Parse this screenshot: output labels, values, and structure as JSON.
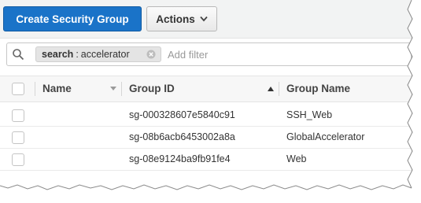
{
  "toolbar": {
    "create_label": "Create Security Group",
    "actions_label": "Actions",
    "primary_color": "#1a73c8"
  },
  "filter": {
    "token_key": "search",
    "token_separator": ":",
    "token_value": "accelerator",
    "placeholder": "Add filter"
  },
  "table": {
    "columns": [
      "Name",
      "Group ID",
      "Group Name"
    ],
    "rows": [
      {
        "name": "",
        "group_id": "sg-000328607e5840c91",
        "group_name": "SSH_Web"
      },
      {
        "name": "",
        "group_id": "sg-08b6acb6453002a8a",
        "group_name": "GlobalAccelerator"
      },
      {
        "name": "",
        "group_id": "sg-08e9124ba9fb91fe4",
        "group_name": "Web"
      }
    ]
  },
  "icons": {
    "search": "magnifier",
    "remove_token": "circle-x",
    "actions_chevron": "chevron-down",
    "name_sort": "triangle-down",
    "group_id_sort": "triangle-up"
  }
}
